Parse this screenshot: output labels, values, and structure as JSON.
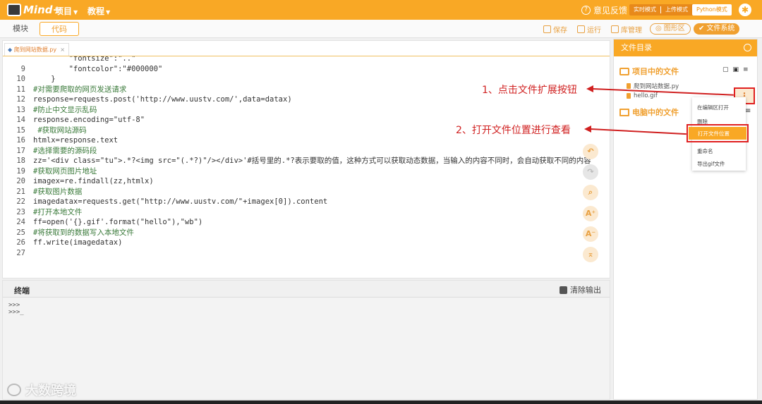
{
  "app": {
    "logo_text": "Mind+",
    "menus": [
      "项目",
      "教程"
    ],
    "feedback_label": "意见反馈",
    "modes": [
      "实时模式",
      "上传模式",
      "Python模式"
    ],
    "active_mode": "Python模式",
    "accent_color": "#f9a825"
  },
  "toolbar": {
    "tab_blocks": "模块",
    "tab_code": "代码",
    "save": "保存",
    "run": "运行",
    "library": "库管理",
    "graphic": "图形区",
    "filesystem": "文件系统"
  },
  "editor": {
    "file_tab": "爬到网站数据.py",
    "close": "×",
    "lines": [
      {
        "n": "",
        "t": "        \"fontsize\":\"..\""
      },
      {
        "n": "9",
        "t": "        \"fontcolor\":\"#000000\""
      },
      {
        "n": "10",
        "t": "    }"
      },
      {
        "n": "11",
        "t": "#对需要爬取的网页发送请求"
      },
      {
        "n": "12",
        "t": "response=requests.post('http://www.uustv.com/',data=datax)"
      },
      {
        "n": "13",
        "t": "#防止中文显示乱码"
      },
      {
        "n": "14",
        "t": "response.encoding=\"utf-8\""
      },
      {
        "n": "15",
        "t": " #获取网站源码"
      },
      {
        "n": "16",
        "t": "htmlx=response.text"
      },
      {
        "n": "17",
        "t": "#选择需要的源码段"
      },
      {
        "n": "18",
        "t": "zz='<div class=\"tu\">.*?<img src=\"(.*?)\"/></div>'#括号里的.*?表示要取的值，这种方式可以获取动态数据，当输入的内容不同时，会自动获取不同的内容"
      },
      {
        "n": "19",
        "t": "#获取网页图片地址"
      },
      {
        "n": "20",
        "t": "imagex=re.findall(zz,htmlx)"
      },
      {
        "n": "21",
        "t": "#获取图片数据"
      },
      {
        "n": "22",
        "t": "imagedatax=requests.get(\"http://www.uustv.com/\"+imagex[0]).content"
      },
      {
        "n": "23",
        "t": "#打开本地文件"
      },
      {
        "n": "24",
        "t": "ff=open('{}.gif'.format(\"hello\"),\"wb\")"
      },
      {
        "n": "25",
        "t": "#将获取到的数据写入本地文件"
      },
      {
        "n": "26",
        "t": "ff.write(imagedatax)"
      },
      {
        "n": "27",
        "t": ""
      }
    ]
  },
  "terminal": {
    "title": "终端",
    "clear_label": "清除输出",
    "output": [
      ">>>",
      ">>>_"
    ]
  },
  "files": {
    "header": "文件目录",
    "project_section": "项目中的文件",
    "project_files": [
      "爬到网站数据.py",
      "hello.gif"
    ],
    "pc_section": "电脑中的文件",
    "context_menu": [
      "在编辑区打开",
      "删除",
      "打开文件位置",
      "重命名",
      "导出gif文件"
    ]
  },
  "annotations": {
    "step1": "1、点击文件扩展按钮",
    "step2": "2、打开文件位置进行查看",
    "color": "#d02020"
  },
  "watermark": "大数跨境"
}
